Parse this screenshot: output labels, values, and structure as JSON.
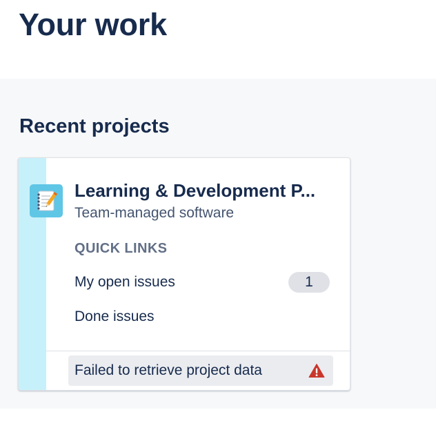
{
  "page": {
    "title": "Your work"
  },
  "recent_projects": {
    "heading": "Recent projects",
    "project": {
      "name": "Learning & Development P...",
      "type": "Team-managed software",
      "avatar_icon": "notebook-pencil-icon",
      "stripe_color": "#c6f1fb",
      "quick_links": {
        "heading": "QUICK LINKS",
        "items": [
          {
            "label": "My open issues",
            "count": "1"
          },
          {
            "label": "Done issues"
          }
        ]
      },
      "error": {
        "message": "Failed to retrieve project data",
        "icon": "warning-icon",
        "icon_color": "#c9372c"
      }
    }
  }
}
